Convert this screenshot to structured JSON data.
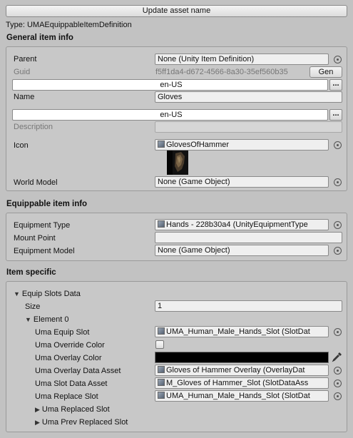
{
  "update_button": "Update asset name",
  "type_line": "Type: UMAEquippableItemDefinition",
  "general": {
    "header": "General item info",
    "parent_label": "Parent",
    "parent_value": "None (Unity Item Definition)",
    "guid_label": "Guid",
    "guid_value": "f5ff1da4-d672-4566-8a30-35ef560b35",
    "gen_button": "Gen",
    "locale1": "en-US",
    "name_label": "Name",
    "name_value": "Gloves",
    "locale2": "en-US",
    "description_label": "Description",
    "description_value": "",
    "icon_label": "Icon",
    "icon_value": "GlovesOfHammer",
    "world_model_label": "World Model",
    "world_model_value": "None (Game Object)"
  },
  "equippable": {
    "header": "Equippable item info",
    "equipment_type_label": "Equipment Type",
    "equipment_type_value": "Hands - 228b30a4 (UnityEquipmentType",
    "mount_point_label": "Mount Point",
    "mount_point_value": "",
    "equipment_model_label": "Equipment Model",
    "equipment_model_value": "None (Game Object)"
  },
  "specific": {
    "header": "Item specific",
    "equip_slots_label": "Equip Slots Data",
    "size_label": "Size",
    "size_value": "1",
    "element_label": "Element 0",
    "uma_equip_slot_label": "Uma Equip Slot",
    "uma_equip_slot_value": "UMA_Human_Male_Hands_Slot (SlotDat",
    "uma_override_color_label": "Uma Override Color",
    "uma_overlay_color_label": "Uma Overlay Color",
    "uma_overlay_color_hex": "#000000",
    "uma_overlay_data_label": "Uma Overlay Data Asset",
    "uma_overlay_data_value": "Gloves of Hammer Overlay (OverlayDat",
    "uma_slot_data_label": "Uma Slot Data Asset",
    "uma_slot_data_value": "M_Gloves of Hammer_Slot (SlotDataAss",
    "uma_replace_slot_label": "Uma Replace Slot",
    "uma_replace_slot_value": "UMA_Human_Male_Hands_Slot (SlotDat",
    "uma_replaced_slot_label": "Uma Replaced Slot",
    "uma_prev_replaced_slot_label": "Uma Prev Replaced Slot"
  },
  "dots_label": "...",
  "icons": {
    "object_picker": "object-picker-icon",
    "eyedropper": "eyedropper-icon",
    "foldout_open": "triangle-down-icon",
    "foldout_closed": "triangle-right-icon"
  }
}
